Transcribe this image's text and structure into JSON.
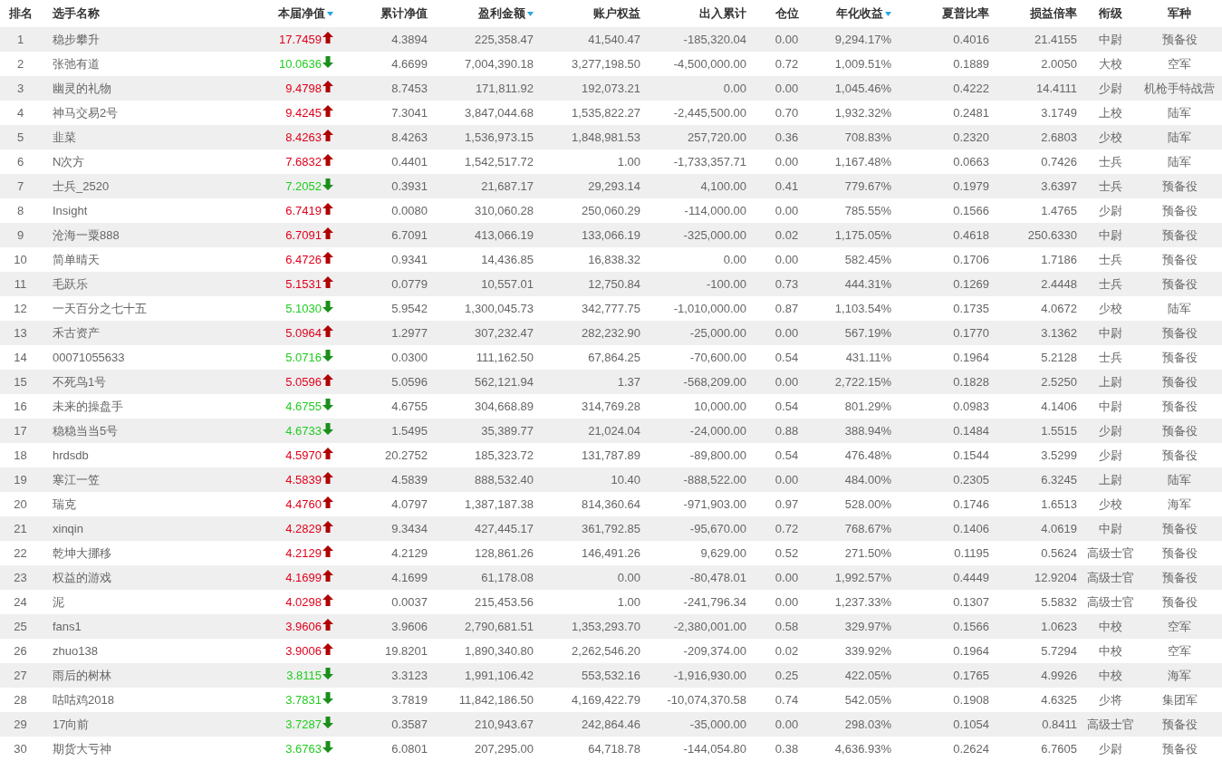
{
  "table": {
    "columns": [
      {
        "label": "排名",
        "sortable": false
      },
      {
        "label": "选手名称",
        "sortable": false
      },
      {
        "label": "本届净值",
        "sortable": true
      },
      {
        "label": "累计净值",
        "sortable": false
      },
      {
        "label": "盈利金额",
        "sortable": true
      },
      {
        "label": "账户权益",
        "sortable": false
      },
      {
        "label": "出入累计",
        "sortable": false
      },
      {
        "label": "仓位",
        "sortable": false
      },
      {
        "label": "年化收益",
        "sortable": true
      },
      {
        "label": "夏普比率",
        "sortable": false
      },
      {
        "label": "损益倍率",
        "sortable": false
      },
      {
        "label": "衔级",
        "sortable": false
      },
      {
        "label": "军种",
        "sortable": false
      }
    ],
    "rows": [
      {
        "rising": true,
        "cells": [
          "1",
          "稳步攀升",
          "17.7459",
          "4.3894",
          "225,358.47",
          "41,540.47",
          "-185,320.04",
          "0.00",
          "9,294.17%",
          "0.4016",
          "21.4155",
          "中尉",
          "预备役"
        ]
      },
      {
        "rising": false,
        "cells": [
          "2",
          "张弛有道",
          "10.0636",
          "4.6699",
          "7,004,390.18",
          "3,277,198.50",
          "-4,500,000.00",
          "0.72",
          "1,009.51%",
          "0.1889",
          "2.0050",
          "大校",
          "空军"
        ]
      },
      {
        "rising": true,
        "cells": [
          "3",
          "幽灵的礼物",
          "9.4798",
          "8.7453",
          "171,811.92",
          "192,073.21",
          "0.00",
          "0.00",
          "1,045.46%",
          "0.4222",
          "14.4111",
          "少尉",
          "机枪手特战营"
        ]
      },
      {
        "rising": true,
        "cells": [
          "4",
          "神马交易2号",
          "9.4245",
          "7.3041",
          "3,847,044.68",
          "1,535,822.27",
          "-2,445,500.00",
          "0.70",
          "1,932.32%",
          "0.2481",
          "3.1749",
          "上校",
          "陆军"
        ]
      },
      {
        "rising": true,
        "cells": [
          "5",
          "韭菜",
          "8.4263",
          "8.4263",
          "1,536,973.15",
          "1,848,981.53",
          "257,720.00",
          "0.36",
          "708.83%",
          "0.2320",
          "2.6803",
          "少校",
          "陆军"
        ]
      },
      {
        "rising": true,
        "cells": [
          "6",
          "N次方",
          "7.6832",
          "0.4401",
          "1,542,517.72",
          "1.00",
          "-1,733,357.71",
          "0.00",
          "1,167.48%",
          "0.0663",
          "0.7426",
          "士兵",
          "陆军"
        ]
      },
      {
        "rising": false,
        "cells": [
          "7",
          "士兵_2520",
          "7.2052",
          "0.3931",
          "21,687.17",
          "29,293.14",
          "4,100.00",
          "0.41",
          "779.67%",
          "0.1979",
          "3.6397",
          "士兵",
          "预备役"
        ]
      },
      {
        "rising": true,
        "cells": [
          "8",
          "Insight",
          "6.7419",
          "0.0080",
          "310,060.28",
          "250,060.29",
          "-114,000.00",
          "0.00",
          "785.55%",
          "0.1566",
          "1.4765",
          "少尉",
          "预备役"
        ]
      },
      {
        "rising": true,
        "cells": [
          "9",
          "沧海一粟888",
          "6.7091",
          "6.7091",
          "413,066.19",
          "133,066.19",
          "-325,000.00",
          "0.02",
          "1,175.05%",
          "0.4618",
          "250.6330",
          "中尉",
          "预备役"
        ]
      },
      {
        "rising": true,
        "cells": [
          "10",
          "简单晴天",
          "6.4726",
          "0.9341",
          "14,436.85",
          "16,838.32",
          "0.00",
          "0.00",
          "582.45%",
          "0.1706",
          "1.7186",
          "士兵",
          "预备役"
        ]
      },
      {
        "rising": true,
        "cells": [
          "11",
          "毛跃乐",
          "5.1531",
          "0.0779",
          "10,557.01",
          "12,750.84",
          "-100.00",
          "0.73",
          "444.31%",
          "0.1269",
          "2.4448",
          "士兵",
          "预备役"
        ]
      },
      {
        "rising": false,
        "cells": [
          "12",
          "一天百分之七十五",
          "5.1030",
          "5.9542",
          "1,300,045.73",
          "342,777.75",
          "-1,010,000.00",
          "0.87",
          "1,103.54%",
          "0.1735",
          "4.0672",
          "少校",
          "陆军"
        ]
      },
      {
        "rising": true,
        "cells": [
          "13",
          "禾古资产",
          "5.0964",
          "1.2977",
          "307,232.47",
          "282,232.90",
          "-25,000.00",
          "0.00",
          "567.19%",
          "0.1770",
          "3.1362",
          "中尉",
          "预备役"
        ]
      },
      {
        "rising": false,
        "cells": [
          "14",
          "00071055633",
          "5.0716",
          "0.0300",
          "111,162.50",
          "67,864.25",
          "-70,600.00",
          "0.54",
          "431.11%",
          "0.1964",
          "5.2128",
          "士兵",
          "预备役"
        ]
      },
      {
        "rising": true,
        "cells": [
          "15",
          "不死鸟1号",
          "5.0596",
          "5.0596",
          "562,121.94",
          "1.37",
          "-568,209.00",
          "0.00",
          "2,722.15%",
          "0.1828",
          "2.5250",
          "上尉",
          "预备役"
        ]
      },
      {
        "rising": false,
        "cells": [
          "16",
          "未来的操盘手",
          "4.6755",
          "4.6755",
          "304,668.89",
          "314,769.28",
          "10,000.00",
          "0.54",
          "801.29%",
          "0.0983",
          "4.1406",
          "中尉",
          "预备役"
        ]
      },
      {
        "rising": false,
        "cells": [
          "17",
          "稳稳当当5号",
          "4.6733",
          "1.5495",
          "35,389.77",
          "21,024.04",
          "-24,000.00",
          "0.88",
          "388.94%",
          "0.1484",
          "1.5515",
          "少尉",
          "预备役"
        ]
      },
      {
        "rising": true,
        "cells": [
          "18",
          "hrdsdb",
          "4.5970",
          "20.2752",
          "185,323.72",
          "131,787.89",
          "-89,800.00",
          "0.54",
          "476.48%",
          "0.1544",
          "3.5299",
          "少尉",
          "预备役"
        ]
      },
      {
        "rising": true,
        "cells": [
          "19",
          "寒江一笠",
          "4.5839",
          "4.5839",
          "888,532.40",
          "10.40",
          "-888,522.00",
          "0.00",
          "484.00%",
          "0.2305",
          "6.3245",
          "上尉",
          "陆军"
        ]
      },
      {
        "rising": true,
        "cells": [
          "20",
          "瑞克",
          "4.4760",
          "4.0797",
          "1,387,187.38",
          "814,360.64",
          "-971,903.00",
          "0.97",
          "528.00%",
          "0.1746",
          "1.6513",
          "少校",
          "海军"
        ]
      },
      {
        "rising": true,
        "cells": [
          "21",
          "xinqin",
          "4.2829",
          "9.3434",
          "427,445.17",
          "361,792.85",
          "-95,670.00",
          "0.72",
          "768.67%",
          "0.1406",
          "4.0619",
          "中尉",
          "预备役"
        ]
      },
      {
        "rising": true,
        "cells": [
          "22",
          "乾坤大挪移",
          "4.2129",
          "4.2129",
          "128,861.26",
          "146,491.26",
          "9,629.00",
          "0.52",
          "271.50%",
          "0.1195",
          "0.5624",
          "高级士官",
          "预备役"
        ]
      },
      {
        "rising": true,
        "cells": [
          "23",
          "权益的游戏",
          "4.1699",
          "4.1699",
          "61,178.08",
          "0.00",
          "-80,478.01",
          "0.00",
          "1,992.57%",
          "0.4449",
          "12.9204",
          "高级士官",
          "预备役"
        ]
      },
      {
        "rising": true,
        "cells": [
          "24",
          "泥",
          "4.0298",
          "0.0037",
          "215,453.56",
          "1.00",
          "-241,796.34",
          "0.00",
          "1,237.33%",
          "0.1307",
          "5.5832",
          "高级士官",
          "预备役"
        ]
      },
      {
        "rising": true,
        "cells": [
          "25",
          "fans1",
          "3.9606",
          "3.9606",
          "2,790,681.51",
          "1,353,293.70",
          "-2,380,001.00",
          "0.58",
          "329.97%",
          "0.1566",
          "1.0623",
          "中校",
          "空军"
        ]
      },
      {
        "rising": true,
        "cells": [
          "26",
          "zhuo138",
          "3.9006",
          "19.8201",
          "1,890,340.80",
          "2,262,546.20",
          "-209,374.00",
          "0.02",
          "339.92%",
          "0.1964",
          "5.7294",
          "中校",
          "空军"
        ]
      },
      {
        "rising": false,
        "cells": [
          "27",
          "雨后的树林",
          "3.8115",
          "3.3123",
          "1,991,106.42",
          "553,532.16",
          "-1,916,930.00",
          "0.25",
          "422.05%",
          "0.1765",
          "4.9926",
          "中校",
          "海军"
        ]
      },
      {
        "rising": false,
        "cells": [
          "28",
          "咕咕鸡2018",
          "3.7831",
          "3.7819",
          "11,842,186.50",
          "4,169,422.79",
          "-10,074,370.58",
          "0.74",
          "542.05%",
          "0.1908",
          "4.6325",
          "少将",
          "集团军"
        ]
      },
      {
        "rising": false,
        "cells": [
          "29",
          "17向前",
          "3.7287",
          "0.3587",
          "210,943.67",
          "242,864.46",
          "-35,000.00",
          "0.00",
          "298.03%",
          "0.1054",
          "0.8411",
          "高级士官",
          "预备役"
        ]
      },
      {
        "rising": false,
        "cells": [
          "30",
          "期货大亏神",
          "3.6763",
          "6.0801",
          "207,295.00",
          "64,718.78",
          "-144,054.80",
          "0.38",
          "4,636.93%",
          "0.2624",
          "6.7605",
          "少尉",
          "预备役"
        ]
      }
    ]
  }
}
